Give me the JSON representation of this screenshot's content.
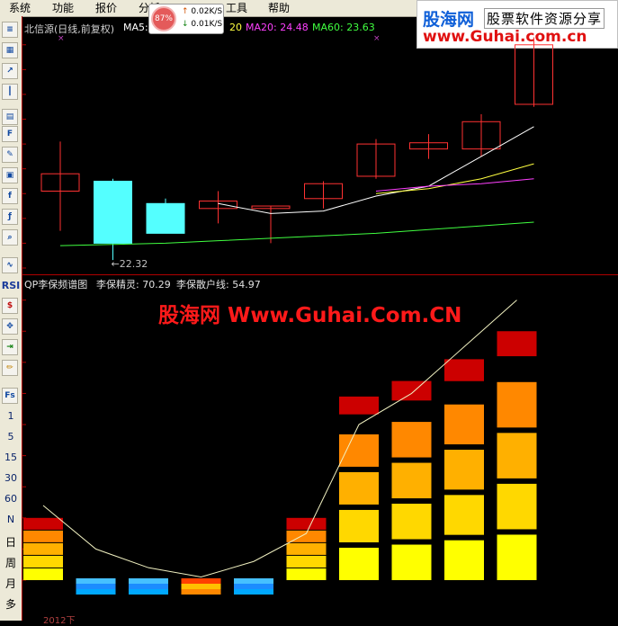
{
  "menu": [
    "系统",
    "功能",
    "报价",
    "分析",
    "工具",
    "帮助"
  ],
  "speed": {
    "percent": "87%",
    "up": "0.02K/S",
    "down": "0.01K/S"
  },
  "logo": {
    "brand": "股海网",
    "slogan": "股票软件资源分享",
    "url": "www.Guhai.com.cn"
  },
  "main_info": {
    "title": "北信源(日线,前复权)",
    "ma5_label": "MA5:",
    "ma10_value": "20",
    "ma20_label": "MA20: 24.48",
    "ma60_label": "MA60: 23.63",
    "colors": {
      "ma5": "#ffffff",
      "ma10": "#ffff40",
      "ma20": "#ff40ff",
      "ma60": "#40ff40"
    }
  },
  "low_label": "←22.32",
  "indicator_info": {
    "title": "QP李保频谱图",
    "spirit": "李保精灵: 70.29",
    "retail": "李保散户线: 54.97"
  },
  "watermark": "股海网 Www.Guhai.Com.CN",
  "bottom_label": "2012下",
  "toolbar_text": {
    "rsi": "RSI",
    "fs": "Fs",
    "periods": [
      "1",
      "5",
      "15",
      "30",
      "60",
      "N",
      "日",
      "周",
      "月",
      "多"
    ]
  },
  "chart_data": [
    {
      "type": "candlestick",
      "title": "北信源(日线,前复权)",
      "candles": [
        {
          "open": 25.1,
          "high": 27.1,
          "low": 23.5,
          "close": 25.8
        },
        {
          "open": 25.5,
          "high": 25.6,
          "low": 22.32,
          "close": 23.0
        },
        {
          "open": 24.6,
          "high": 24.8,
          "low": 23.9,
          "close": 23.4
        },
        {
          "open": 24.4,
          "high": 25.1,
          "low": 23.8,
          "close": 24.7
        },
        {
          "open": 24.4,
          "high": 24.5,
          "low": 23.0,
          "close": 24.5
        },
        {
          "open": 24.8,
          "high": 25.5,
          "low": 24.4,
          "close": 25.4
        },
        {
          "open": 25.7,
          "high": 27.2,
          "low": 25.6,
          "close": 27.0
        },
        {
          "open": 26.8,
          "high": 27.4,
          "low": 26.4,
          "close": 27.05
        },
        {
          "open": 26.8,
          "high": 28.2,
          "low": 26.5,
          "close": 27.9
        },
        {
          "open": 28.6,
          "high": 31.3,
          "low": 28.5,
          "close": 31.0
        }
      ],
      "ma_series": [
        {
          "name": "MA5",
          "values": [
            null,
            null,
            null,
            24.6,
            24.2,
            24.3,
            24.9,
            25.3,
            26.5,
            27.7
          ]
        },
        {
          "name": "MA10",
          "values": [
            null,
            null,
            null,
            null,
            null,
            null,
            25.0,
            25.2,
            25.6,
            26.2
          ]
        },
        {
          "name": "MA20",
          "values": [
            null,
            null,
            null,
            null,
            null,
            null,
            25.1,
            25.3,
            25.4,
            25.6
          ]
        },
        {
          "name": "MA60",
          "values": [
            22.9,
            22.95,
            23.0,
            23.1,
            23.2,
            23.3,
            23.4,
            23.55,
            23.7,
            23.85
          ]
        }
      ],
      "ylim": [
        22,
        31.5
      ]
    },
    {
      "type": "bar",
      "title": "QP李保频谱图",
      "series": [
        {
          "name": "李保精灵",
          "values": [
            40,
            10,
            10,
            14,
            14,
            40,
            118,
            128,
            142,
            160
          ]
        },
        {
          "name": "李保散户线",
          "values": [
            48,
            20,
            8,
            2,
            12,
            30,
            100,
            120,
            150,
            180
          ]
        }
      ],
      "ylim": [
        0,
        185
      ]
    }
  ]
}
